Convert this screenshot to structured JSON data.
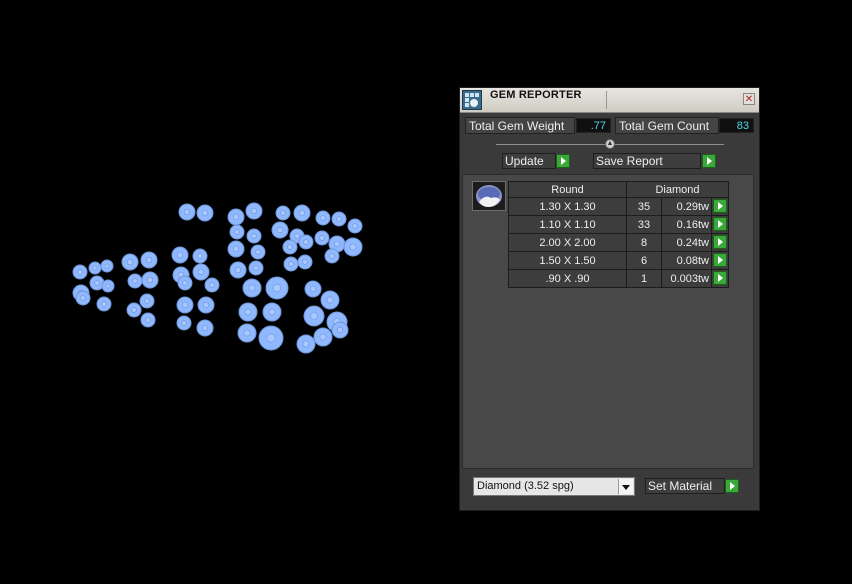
{
  "panel": {
    "title": "GEM REPORTER",
    "close_glyph": "✕",
    "total_gem_weight_label": "Total Gem Weight",
    "total_gem_weight_value": ".77",
    "total_gem_count_label": "Total Gem Count",
    "total_gem_count_value": "83",
    "update_label": "Update",
    "save_report_label": "Save Report",
    "table": {
      "headers": [
        "Round",
        "Diamond"
      ],
      "rows": [
        {
          "size": "1.30 X 1.30",
          "count": "35",
          "weight": "0.29tw"
        },
        {
          "size": "1.10 X 1.10",
          "count": "33",
          "weight": "0.16tw"
        },
        {
          "size": "2.00 X 2.00",
          "count": "8",
          "weight": "0.24tw"
        },
        {
          "size": "1.50 X 1.50",
          "count": "6",
          "weight": "0.08tw"
        },
        {
          "size": ".90 X .90",
          "count": "1",
          "weight": "0.003tw"
        }
      ]
    },
    "material_select_value": "Diamond     (3.52 spg)",
    "set_material_label": "Set Material"
  },
  "colors": {
    "gem_fill": "#8fb8ff",
    "gem_stroke": "#6f95d9",
    "value_text": "#4fd6ea",
    "go_button": "#38a838"
  },
  "icons": {
    "title_icon": "gem-reporter-icon",
    "close": "close-icon",
    "go": "play-arrow-icon",
    "dropdown": "chevron-down-icon",
    "thumbnail": "round-gem-icon"
  }
}
